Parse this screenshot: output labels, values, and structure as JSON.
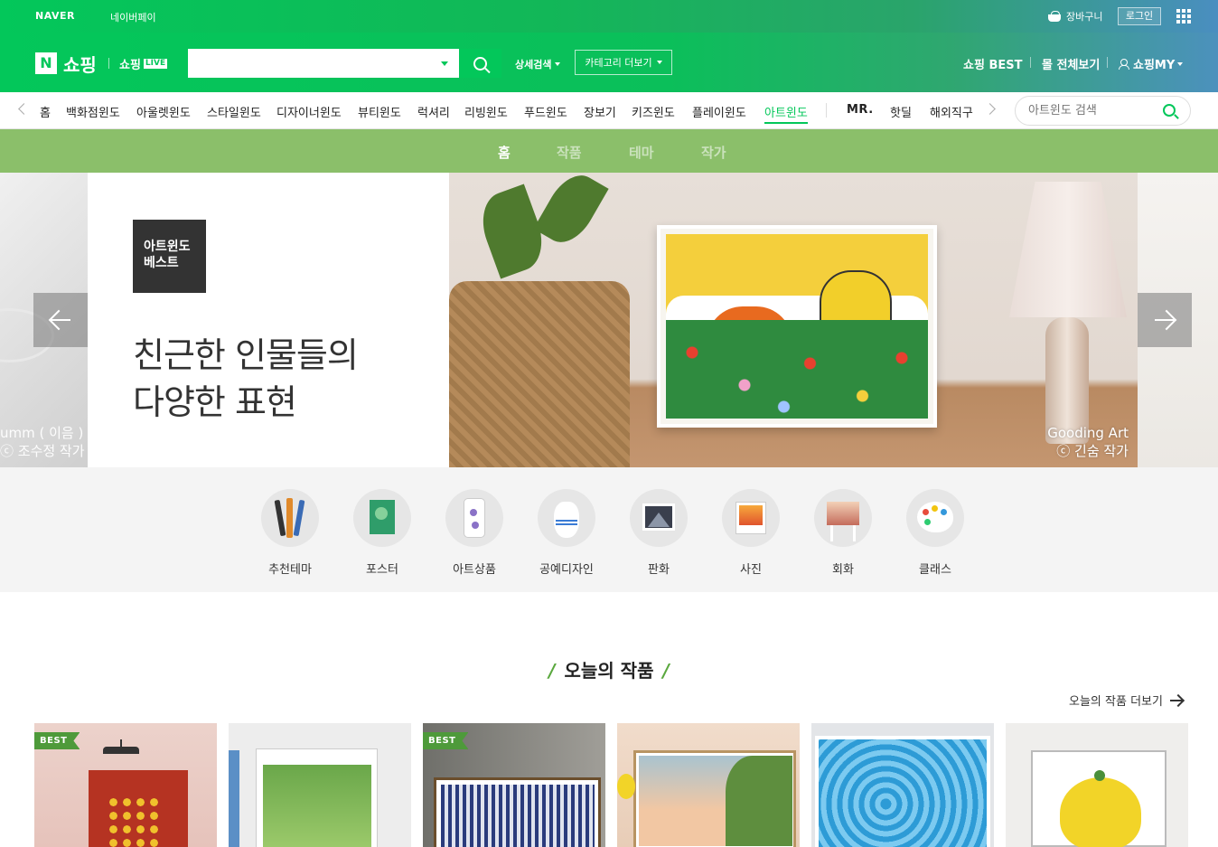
{
  "topbar": {
    "naver": "NAVER",
    "npay": "네이버페이",
    "cart": "장바구니",
    "login": "로그인",
    "apps_icon": "grid-icon"
  },
  "header": {
    "logo": "N",
    "logo_text": "쇼핑",
    "live_text": "쇼핑",
    "live_badge": "LIVE",
    "search": {
      "value": "",
      "placeholder": ""
    },
    "detail_search": "상세검색",
    "category_more": "카테고리 더보기",
    "best": "쇼핑 BEST",
    "all_malls": "몰 전체보기",
    "my": "쇼핑MY"
  },
  "catnav": {
    "items": [
      "홈",
      "백화점윈도",
      "아울렛윈도",
      "스타일윈도",
      "디자이너윈도",
      "뷰티윈도",
      "럭셔리",
      "리빙윈도",
      "푸드윈도",
      "장보기",
      "키즈윈도",
      "플레이윈도",
      "아트윈도",
      "MR.",
      "핫딜",
      "해외직구"
    ],
    "active": "아트윈도",
    "search_placeholder": "아트윈도 검색"
  },
  "subnav": {
    "tabs": [
      "홈",
      "작품",
      "테마",
      "작가"
    ],
    "active": "홈"
  },
  "hero": {
    "badge_line1": "아트윈도",
    "badge_line2": "베스트",
    "title_line1": "친근한 인물들의",
    "title_line2": "다양한 표현",
    "caption_line1": "Gooding Art",
    "caption_line2": "ⓒ 긴숨 작가",
    "prev_caption_line1": "umm ( 이음 )",
    "prev_caption_line2": "ⓒ 조수정 작가"
  },
  "categories": [
    {
      "label": "추천테마",
      "icon": "brushes-icon"
    },
    {
      "label": "포스터",
      "icon": "poster-icon"
    },
    {
      "label": "아트상품",
      "icon": "phonecase-icon"
    },
    {
      "label": "공예디자인",
      "icon": "vase-icon"
    },
    {
      "label": "판화",
      "icon": "print-icon"
    },
    {
      "label": "사진",
      "icon": "photo-icon"
    },
    {
      "label": "회화",
      "icon": "easel-icon"
    },
    {
      "label": "클래스",
      "icon": "palette-icon"
    }
  ],
  "today": {
    "title": "오늘의 작품",
    "more": "오늘의 작품 더보기",
    "cards": [
      {
        "badge": "BEST",
        "colors": [
          "#e8c7c0",
          "#b53322"
        ]
      },
      {
        "badge": "",
        "colors": [
          "#e9e9e9",
          "#6aa74a"
        ]
      },
      {
        "badge": "BEST",
        "colors": [
          "#8b8b86",
          "#2a3b7c"
        ]
      },
      {
        "badge": "",
        "colors": [
          "#f0d8c4",
          "#5e8e3e"
        ]
      },
      {
        "badge": "",
        "colors": [
          "#dfe3e8",
          "#2d9bd6"
        ]
      },
      {
        "badge": "",
        "colors": [
          "#ededeb",
          "#f2d428"
        ]
      }
    ]
  },
  "colors": {
    "brand": "#03c75a",
    "subnav": "#8bbf6a"
  }
}
